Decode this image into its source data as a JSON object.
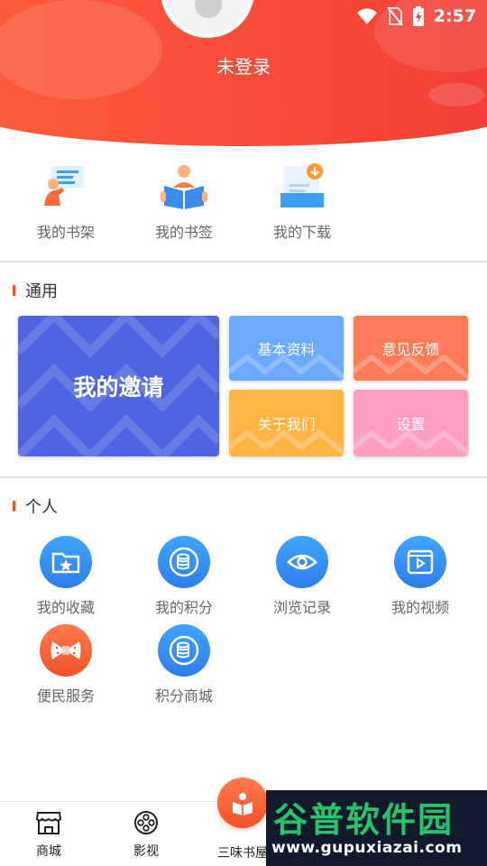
{
  "status": {
    "time": "2:57"
  },
  "profile": {
    "login_status": "未登录"
  },
  "quick": [
    {
      "label": "我的书架",
      "icon": "bookshelf-icon"
    },
    {
      "label": "我的书签",
      "icon": "bookmark-reader-icon"
    },
    {
      "label": "我的下载",
      "icon": "download-icon"
    }
  ],
  "general": {
    "title": "通用",
    "invite": "我的邀请",
    "basic_info": "基本资料",
    "feedback": "意见反馈",
    "about": "关于我们",
    "settings": "设置"
  },
  "personal": {
    "title": "个人",
    "items": [
      {
        "label": "我的收藏",
        "icon": "favorite-folder-icon"
      },
      {
        "label": "我的积分",
        "icon": "coins-icon"
      },
      {
        "label": "浏览记录",
        "icon": "eye-icon"
      },
      {
        "label": "我的视频",
        "icon": "video-icon"
      },
      {
        "label": "便民服务",
        "icon": "bow-icon"
      },
      {
        "label": "积分商城",
        "icon": "coins-icon"
      }
    ]
  },
  "bottom_nav": [
    {
      "label": "商城",
      "icon": "store-icon"
    },
    {
      "label": "影视",
      "icon": "film-reel-icon"
    },
    {
      "label": "三味书屋",
      "icon": "reading-icon"
    }
  ],
  "watermark": {
    "title": "谷普软件园",
    "url": "www.gupuxiazai.com"
  },
  "colors": {
    "header": "#f23d36",
    "accent": "#f4511e",
    "invite": "#4f63e0",
    "basic_info": "#6aa9ff",
    "feedback": "#ff7a56",
    "about": "#ffb444",
    "settings": "#ff9ec2"
  }
}
